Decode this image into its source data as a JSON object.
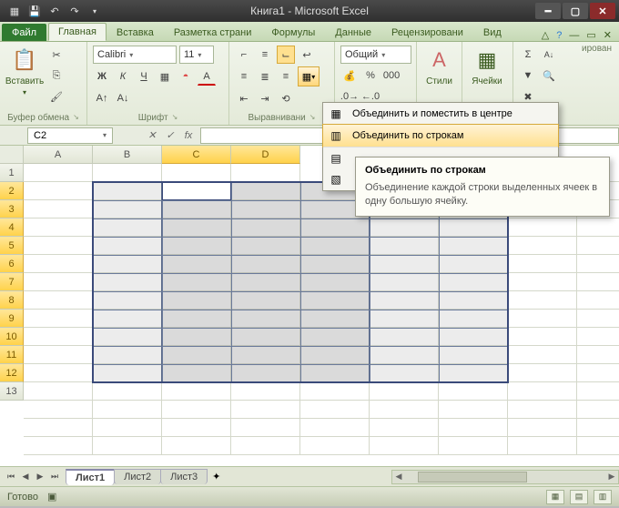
{
  "app": {
    "title": "Книга1 - Microsoft Excel"
  },
  "tabs": {
    "file": "Файл",
    "home": "Главная",
    "insert": "Вставка",
    "layout": "Разметка страни",
    "formulas": "Формулы",
    "data": "Данные",
    "review": "Рецензировани",
    "view": "Вид"
  },
  "groups": {
    "clipboard": {
      "label": "Буфер обмена",
      "paste": "Вставить"
    },
    "font": {
      "label": "Шрифт",
      "name": "Calibri",
      "size": "11"
    },
    "align": {
      "label": "Выравнивани"
    },
    "number": {
      "label": "ирован",
      "format": "Общий"
    },
    "styles": {
      "label": "Стили",
      "btn": "Стили"
    },
    "cells": {
      "label": "Ячейки",
      "btn": "Ячейки"
    }
  },
  "namebox": "C2",
  "merge_menu": {
    "item1": "Объединить и поместить в центре",
    "item2": "Объединить по строкам"
  },
  "tooltip": {
    "title": "Объединить по строкам",
    "body": "Объединение каждой строки выделенных ячеек в одну большую ячейку."
  },
  "cols": [
    "A",
    "B",
    "C",
    "D"
  ],
  "rows": [
    "1",
    "2",
    "3",
    "4",
    "5",
    "6",
    "7",
    "8",
    "9",
    "10",
    "11",
    "12",
    "13"
  ],
  "sheets": {
    "s1": "Лист1",
    "s2": "Лист2",
    "s3": "Лист3"
  },
  "status": "Готово"
}
